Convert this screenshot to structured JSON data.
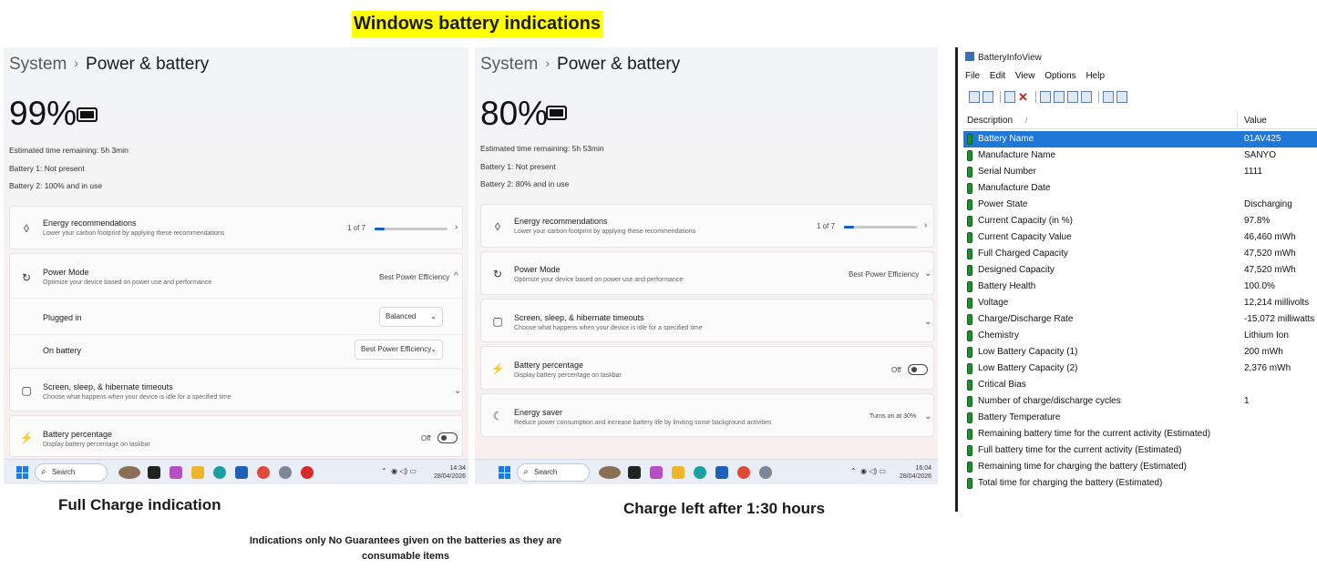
{
  "headline": "Windows battery indications",
  "captions": {
    "left": "Full Charge indication",
    "middle": "Charge left after 1:30 hours"
  },
  "disclaimer": "Indications only No Guarantees given on the batteries as they are consumable items",
  "left_panel": {
    "breadcrumb_parent": "System",
    "breadcrumb_current": "Power & battery",
    "percentage": "99%",
    "est_label": "Estimated time remaining:",
    "est_value": "5h 3min",
    "battery1_label": "Battery 1:",
    "battery1_value": "Not present",
    "battery2_label": "Battery 2:",
    "battery2_value": "100% and in use",
    "energy_title": "Energy recommendations",
    "energy_sub": "Lower your carbon footprint by applying these recommendations",
    "energy_count": "1 of 7",
    "energy_progress": 0.14,
    "power_mode_title": "Power Mode",
    "power_mode_sub": "Optimize your device based on power use and performance",
    "power_mode_value": "Best Power Efficiency",
    "plugged_in_label": "Plugged in",
    "plugged_in_value": "Balanced",
    "on_battery_label": "On battery",
    "on_battery_value": "Best Power Efficiency",
    "screen_title": "Screen, sleep, & hibernate timeouts",
    "screen_sub": "Choose what happens when your device is idle for a specified time",
    "bp_title": "Battery percentage",
    "bp_sub": "Display battery percentage on taskbar",
    "bp_state": "Off",
    "search": "Search",
    "time": "14:34",
    "date": "28/04/2026"
  },
  "middle_panel": {
    "breadcrumb_parent": "System",
    "breadcrumb_current": "Power & battery",
    "percentage": "80%",
    "est_label": "Estimated time remaining:",
    "est_value": "5h 53min",
    "battery1_label": "Battery 1:",
    "battery1_value": "Not present",
    "battery2_label": "Battery 2:",
    "battery2_value": "80% and in use",
    "energy_title": "Energy recommendations",
    "energy_sub": "Lower your carbon footprint by applying these recommendations",
    "energy_count": "1 of 7",
    "energy_progress": 0.14,
    "power_mode_title": "Power Mode",
    "power_mode_sub": "Optimize your device based on power use and performance",
    "power_mode_value": "Best Power Efficiency",
    "screen_title": "Screen, sleep, & hibernate timeouts",
    "screen_sub": "Choose what happens when your device is idle for a specified time",
    "bp_title": "Battery percentage",
    "bp_sub": "Display battery percentage on taskbar",
    "bp_state": "Off",
    "saver_title": "Energy saver",
    "saver_sub": "Reduce power consumption and increase battery life by limiting some background activities",
    "saver_value": "Turns on at 30%",
    "search": "Search",
    "time": "16:04",
    "date": "28/04/2026"
  },
  "biv": {
    "title": "BatteryInfoView",
    "menu": [
      "File",
      "Edit",
      "View",
      "Options",
      "Help"
    ],
    "col_desc": "Description",
    "col_sort": "/",
    "col_value": "Value",
    "rows": [
      {
        "name": "Battery Name",
        "value": "01AV425"
      },
      {
        "name": "Manufacture Name",
        "value": "SANYO"
      },
      {
        "name": "Serial Number",
        "value": "1111"
      },
      {
        "name": "Manufacture Date",
        "value": ""
      },
      {
        "name": "Power State",
        "value": "Discharging"
      },
      {
        "name": "Current Capacity (in %)",
        "value": "97.8%"
      },
      {
        "name": "Current Capacity Value",
        "value": "46,460 mWh"
      },
      {
        "name": "Full Charged Capacity",
        "value": "47,520 mWh"
      },
      {
        "name": "Designed Capacity",
        "value": "47,520 mWh"
      },
      {
        "name": "Battery Health",
        "value": "100.0%"
      },
      {
        "name": "Voltage",
        "value": "12,214 millivolts"
      },
      {
        "name": "Charge/Discharge Rate",
        "value": "-15,072 milliwatts"
      },
      {
        "name": "Chemistry",
        "value": "Lithium Ion"
      },
      {
        "name": "Low Battery Capacity (1)",
        "value": "200 mWh"
      },
      {
        "name": "Low Battery Capacity (2)",
        "value": "2,376 mWh"
      },
      {
        "name": "Critical Bias",
        "value": ""
      },
      {
        "name": "Number of charge/discharge cycles",
        "value": "1"
      },
      {
        "name": "Battery Temperature",
        "value": ""
      },
      {
        "name": "Remaining battery time for the current activity (Estimated)",
        "value": ""
      },
      {
        "name": "Full battery time for the current activity (Estimated)",
        "value": ""
      },
      {
        "name": "Remaining time for charging the battery (Estimated)",
        "value": ""
      },
      {
        "name": "Total  time for charging the battery (Estimated)",
        "value": ""
      }
    ]
  }
}
